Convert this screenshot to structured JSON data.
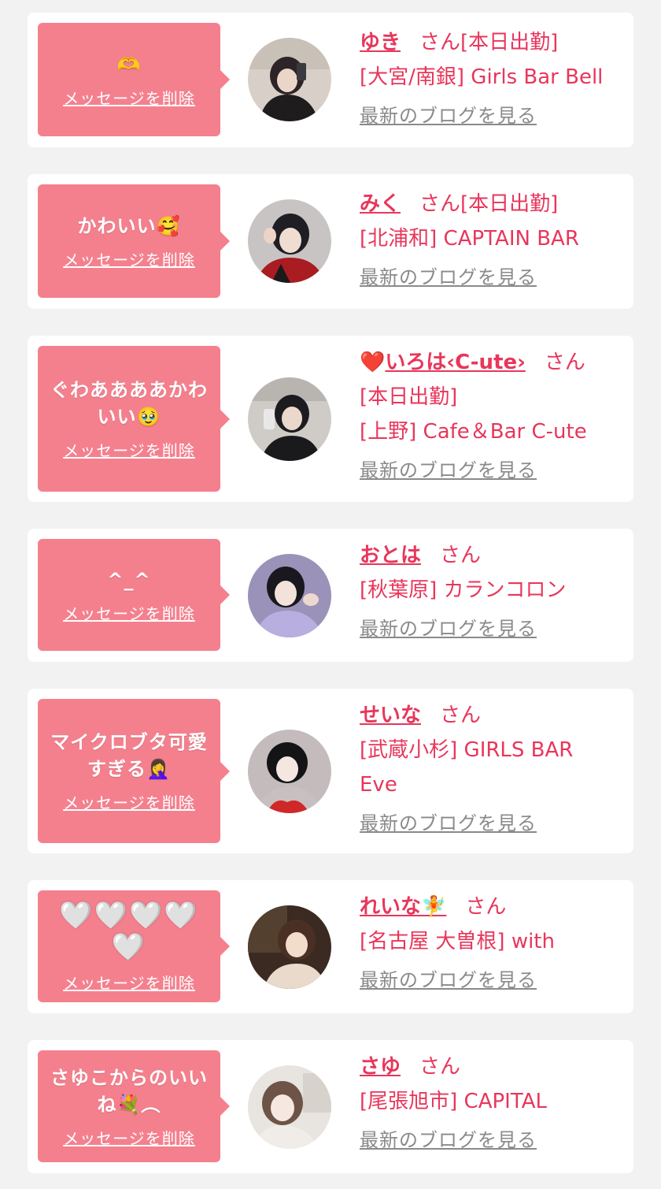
{
  "delete_label": "メッセージを削除",
  "blog_label": "最新のブログを見る",
  "honorific": "さん",
  "colors": {
    "accent": "#e8365b",
    "bubble": "#f4808e",
    "background": "#f2f2f2",
    "link_gray": "#8a8a8a"
  },
  "cards": [
    {
      "message": "🫶",
      "name": "ゆき",
      "status": "[本日出勤]",
      "shop": "[大宮/南銀] Girls Bar Bell",
      "avatar_colors": [
        "#3a3030",
        "#d8d0c8"
      ]
    },
    {
      "message": "かわいい🥰",
      "name": "みく",
      "status": "[本日出勤]",
      "shop": "[北浦和] CAPTAIN BAR",
      "avatar_colors": [
        "#2a2a30",
        "#b82020"
      ]
    },
    {
      "message": "ぐわああああかわいい🥹",
      "name_prefix": "❤️",
      "name": "いろは‹C-ute›",
      "status": "[本日出勤]",
      "shop": "[上野] Cafe＆Bar C-ute",
      "avatar_colors": [
        "#222225",
        "#c8c4c0"
      ]
    },
    {
      "message": "^_^",
      "name": "おとは",
      "shop": "[秋葉原] カランコロン",
      "avatar_colors": [
        "#1e1e24",
        "#b0a8d0"
      ]
    },
    {
      "message": "マイクロブタ可愛すぎる🤦‍♀️",
      "name": "せいな",
      "shop": "[武蔵小杉] GIRLS BAR Eve",
      "avatar_colors": [
        "#1a1a1a",
        "#d02828"
      ]
    },
    {
      "message": "🤍🤍🤍🤍🤍",
      "name": "れいな🧚",
      "shop": "[名古屋 大曽根] with",
      "avatar_colors": [
        "#3a2a22",
        "#e8d0b8"
      ]
    },
    {
      "message": "さゆこからのいいね💐︵",
      "name": "さゆ",
      "shop": "[尾張旭市] CAPITAL",
      "avatar_colors": [
        "#e8e4e0",
        "#8a7060"
      ]
    }
  ]
}
